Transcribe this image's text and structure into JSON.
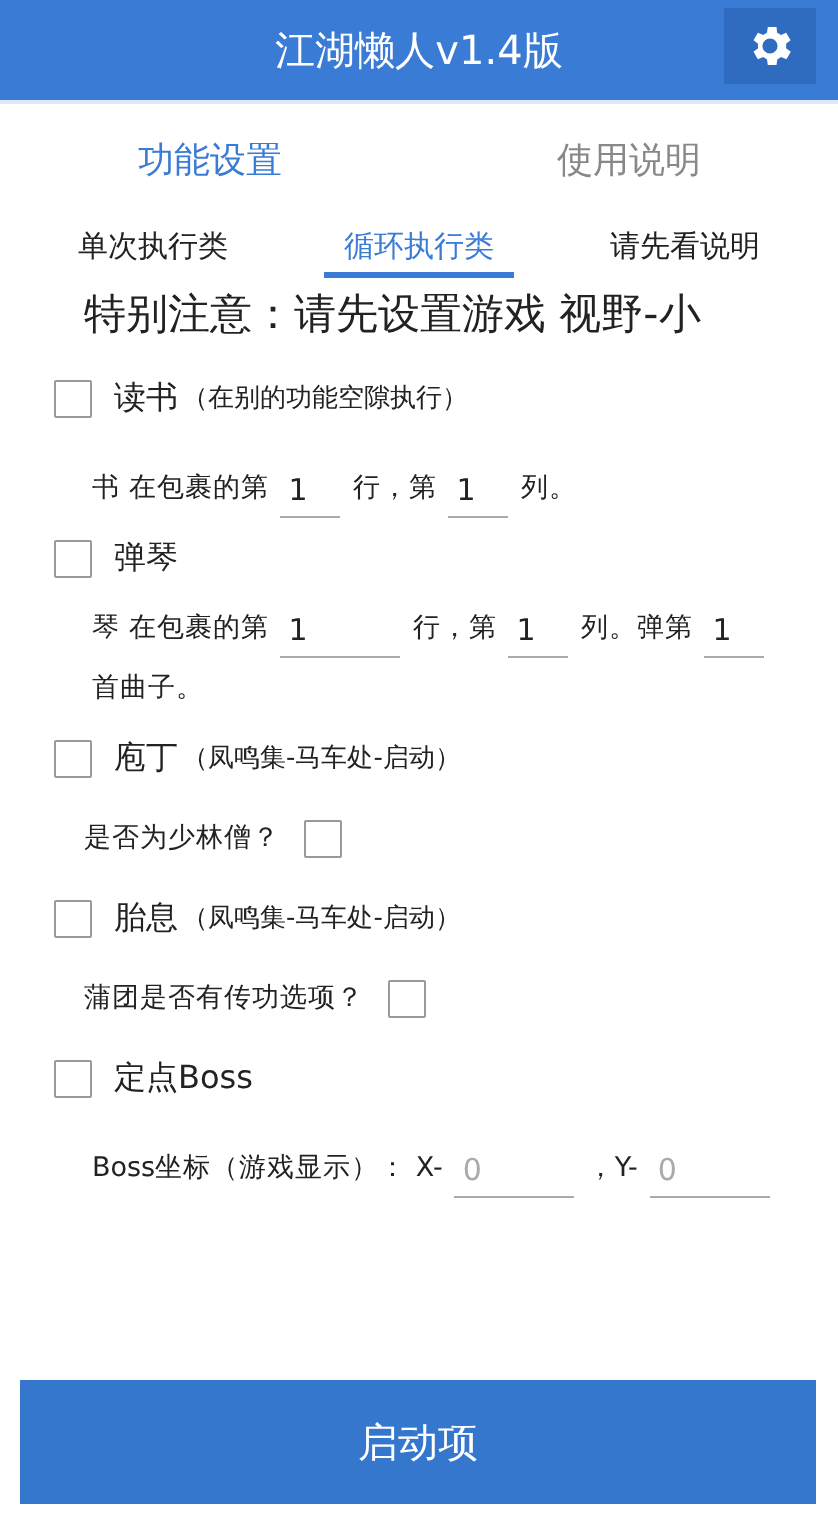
{
  "app_bar": {
    "title": "江湖懒人v1.4版"
  },
  "tabs": [
    {
      "label": "功能设置",
      "selected": true
    },
    {
      "label": "使用说明",
      "selected": false
    }
  ],
  "sub_tabs": [
    {
      "label": "单次执行类",
      "selected": false
    },
    {
      "label": "循环执行类",
      "selected": true
    },
    {
      "label": "请先看说明",
      "selected": false
    }
  ],
  "notice": "特别注意：请先设置游戏  视野-小",
  "rows": [
    {
      "kind": "check",
      "label": "读书",
      "note": "（在别的功能空隙执行）",
      "checked": false
    },
    {
      "kind": "fields",
      "parts": [
        {
          "kind": "text",
          "text": "书 在包裹的第"
        },
        {
          "kind": "field",
          "value": "1"
        },
        {
          "kind": "text",
          "text": "行，第"
        },
        {
          "kind": "field",
          "value": "1"
        },
        {
          "kind": "text",
          "text": "列。"
        }
      ]
    },
    {
      "kind": "check",
      "label": "弹琴",
      "checked": false
    },
    {
      "kind": "fields",
      "parts": [
        {
          "kind": "text",
          "text": "琴 在包裹的第"
        },
        {
          "kind": "field",
          "value": "1",
          "wide": true
        },
        {
          "kind": "text",
          "text": "行，第"
        },
        {
          "kind": "field",
          "value": "1"
        },
        {
          "kind": "text",
          "text": "列。弹第"
        },
        {
          "kind": "field",
          "value": "1"
        },
        {
          "kind": "text",
          "text": "首曲子。"
        }
      ]
    },
    {
      "kind": "check",
      "label": "庖丁",
      "note": "（凤鸣集-马车处-启动）",
      "checked": false
    },
    {
      "kind": "sub_check",
      "label": "是否为少林僧？",
      "checked": false
    },
    {
      "kind": "check",
      "label": "胎息",
      "note": "（凤鸣集-马车处-启动）",
      "checked": false
    },
    {
      "kind": "sub_check",
      "label": "蒲团是否有传功选项？",
      "checked": false
    },
    {
      "kind": "check",
      "label": "定点Boss",
      "checked": false
    },
    {
      "kind": "fields",
      "parts": [
        {
          "kind": "text",
          "text": "Boss坐标（游戏显示）：  X-"
        },
        {
          "kind": "field",
          "placeholder": "0",
          "wide": true
        },
        {
          "kind": "text",
          "text": "，Y-"
        },
        {
          "kind": "field",
          "placeholder": "0",
          "wide": true
        }
      ]
    }
  ],
  "start_button": "启动项"
}
